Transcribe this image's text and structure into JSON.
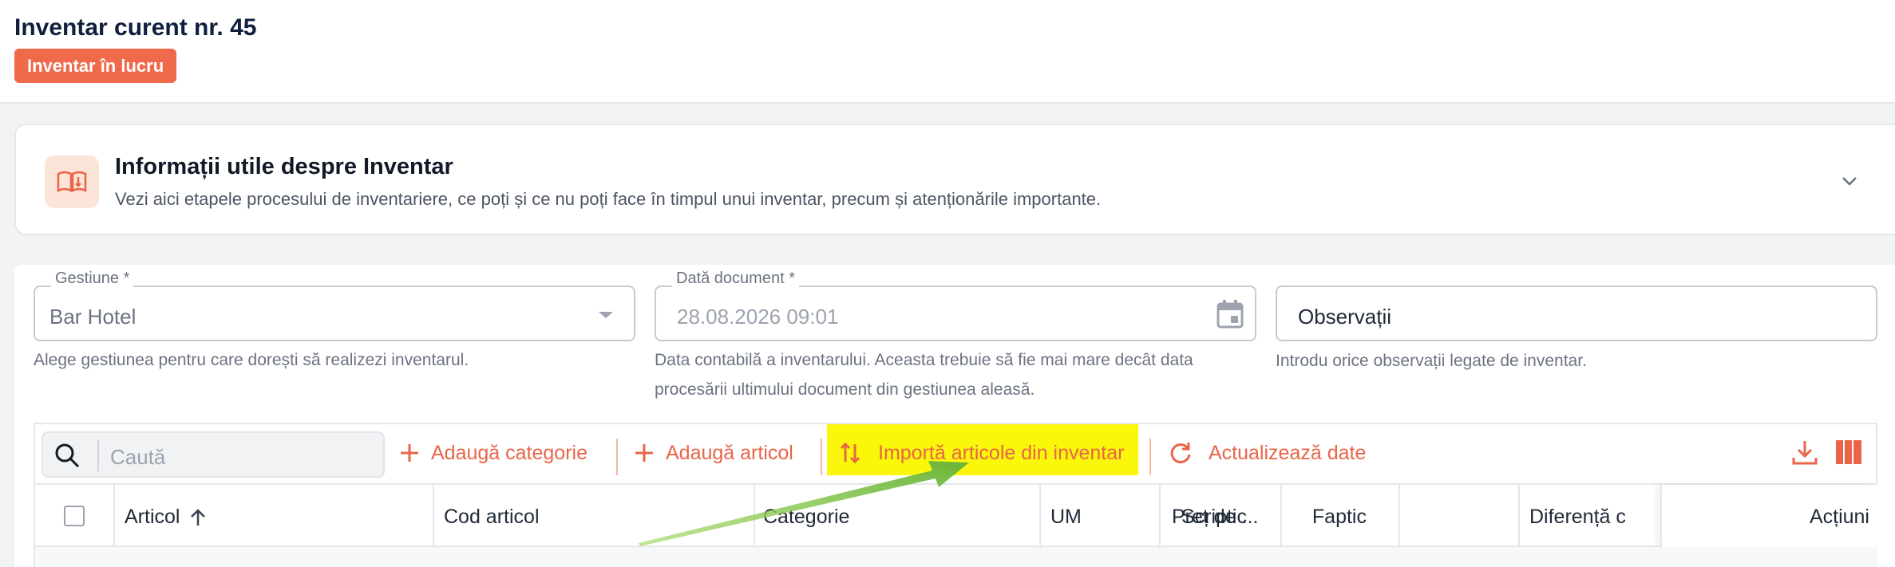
{
  "header": {
    "title": "Inventar curent nr. 45",
    "status": "Inventar în lucru"
  },
  "info": {
    "title": "Informații utile despre Inventar",
    "description": "Vezi aici etapele procesului de inventariere, ce poți și ce nu poți face în timpul unui inventar, precum și atenționările importante."
  },
  "form": {
    "gestiune": {
      "label": "Gestiune *",
      "value": "Bar Hotel",
      "helper": "Alege gestiunea pentru care dorești să realizezi inventarul."
    },
    "data": {
      "label": "Dată document *",
      "value": "28.08.2026 09:01",
      "helper_line1": "Data contabilă a inventarului. Aceasta trebuie să fie mai mare decât data",
      "helper_line2": "procesării ultimului document din gestiunea aleasă."
    },
    "observatii": {
      "value": "Observații",
      "helper": "Introdu orice observații legate de inventar."
    }
  },
  "toolbar": {
    "search_placeholder": "Caută",
    "add_category": "Adaugă categorie",
    "add_article": "Adaugă articol",
    "import": "Importă articole din inventar",
    "refresh": "Actualizează date"
  },
  "table": {
    "columns": [
      "Articol",
      "Cod articol",
      "Categorie",
      "UM",
      "Preț de ...",
      "Scriptic",
      "Faptic",
      "Diferență c",
      "Acțiuni"
    ]
  },
  "colors": {
    "accent": "#e8654a",
    "badge": "#ef6a4b",
    "highlight": "#fbf70a",
    "annotation_arrow": "#7dc142"
  }
}
